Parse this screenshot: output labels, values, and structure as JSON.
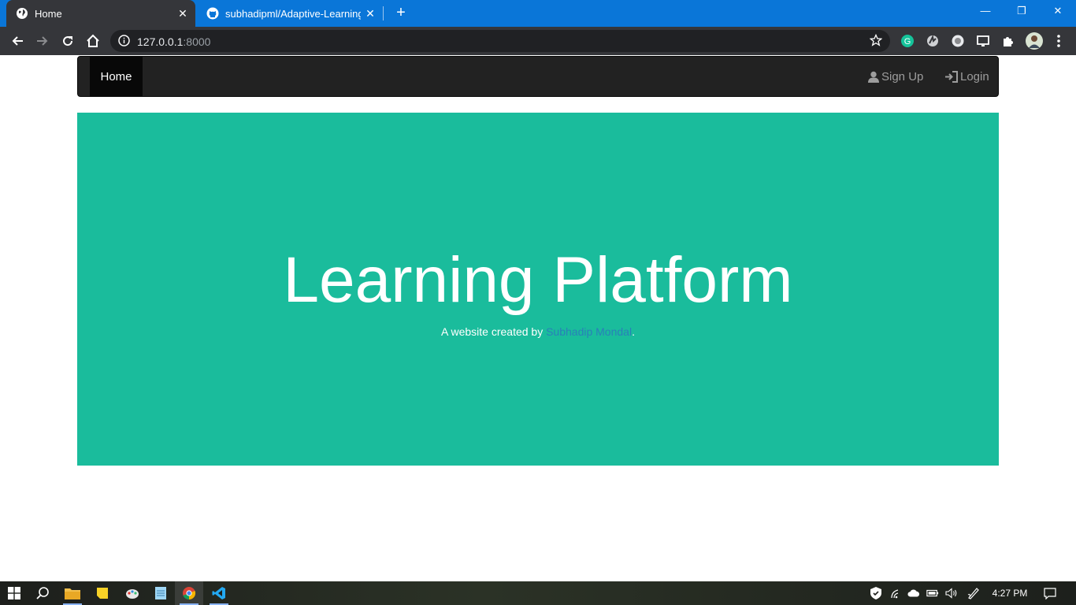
{
  "browser": {
    "tabs": [
      {
        "title": "Home",
        "icon": "globe-icon",
        "active": true
      },
      {
        "title": "subhadipml/Adaptive-Learning-P",
        "icon": "github-icon",
        "active": false
      }
    ],
    "new_tab_label": "+",
    "address": {
      "host": "127.0.0.1",
      "port": ":8000"
    },
    "window_controls": {
      "minimize": "—",
      "restore": "❐",
      "close": "✕"
    }
  },
  "site": {
    "nav": {
      "home": "Home",
      "sign_up": "Sign Up",
      "login": "Login"
    },
    "hero": {
      "title": "Learning Platform",
      "byline_prefix": "A website created by ",
      "author": "Subhadip Mondal",
      "byline_suffix": "."
    },
    "colors": {
      "hero_bg": "#1abc9c",
      "navbar_bg": "#222222",
      "link": "#2980b9"
    }
  },
  "taskbar": {
    "clock": "4:27 PM",
    "apps": [
      "windows-start-icon",
      "search-icon",
      "file-explorer-icon",
      "sticky-notes-icon",
      "paint-icon",
      "notepad-icon",
      "chrome-icon",
      "vscode-icon"
    ]
  }
}
